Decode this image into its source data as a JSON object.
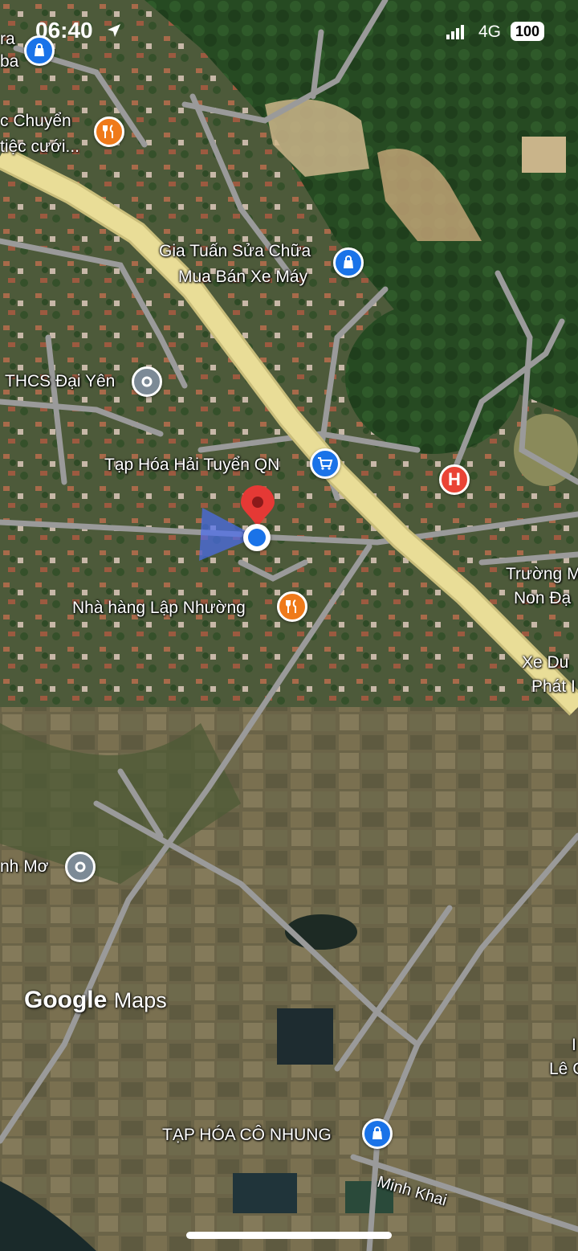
{
  "status_bar": {
    "time": "06:40",
    "network": "4G",
    "battery": "100"
  },
  "colors": {
    "highway": "#e9dd97",
    "road": "#9a9a9a",
    "shop_pin": "#1a73e8",
    "food_pin": "#ef7a1a",
    "hospital_pin": "#ea4335",
    "poi_pin": "#7c8a96",
    "my_location": "#1a73e8",
    "dropped_pin": "#e53935"
  },
  "map": {
    "labels": {
      "top_left_a": "ra",
      "top_left_b": "ba",
      "wedding": "c Chuyển",
      "wedding_2": "tiệc cưới...",
      "gia_tuan": "Gia Tuấn Sửa Chữa",
      "gia_tuan_2": "Mua Bán Xe Máy",
      "thcs": "THCS Đại Yên",
      "tap_hoa_hai_tuyen": "Tạp Hóa Hải Tuyển QN",
      "truong": "Trường M",
      "truong_2": "Non Đạ",
      "nha_hang": "Nhà hàng Lập Nhường",
      "xe_du": "Xe Du",
      "xe_du_2": "Phát I",
      "minh_mo": "nh Mơ",
      "le_c": "Lê C",
      "le_c_top": "I",
      "tap_hoa_co_nhung": "TẠP HÓA CÔ NHUNG",
      "minh_khai": "Minh Khai"
    },
    "icons": {
      "shop": "shopping-bag-icon",
      "grocery": "shopping-cart-icon",
      "food": "fork-knife-icon",
      "hospital": "hospital-icon",
      "poi": "location-icon"
    }
  },
  "branding": {
    "google": "Google",
    "maps": "Maps"
  }
}
